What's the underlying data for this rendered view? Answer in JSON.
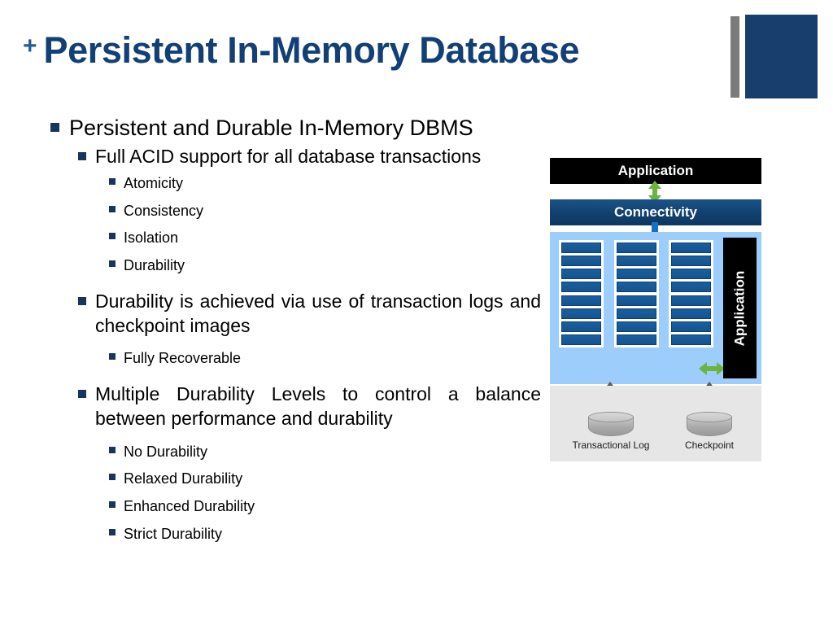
{
  "slide": {
    "title_prefix": "+",
    "title": "Persistent In-Memory Database"
  },
  "colors": {
    "title_blue": "#124076",
    "bullet_navy": "#18365c",
    "deco_block": "#173e6d",
    "deco_bar": "#7b7b7b",
    "connectivity_blue": "#11406f",
    "memory_bg": "#9dcdfa",
    "memory_row": "#14538f",
    "storage_bg": "#e6e6e6",
    "arrow_green": "#6cb33f",
    "arrow_blue": "#1b6fc2",
    "arrow_gray": "#5a5a5a",
    "black": "#000000",
    "white": "#ffffff"
  },
  "bullets": {
    "b1": "Persistent and Durable In-Memory DBMS",
    "b2": "Full ACID support for all database transactions",
    "acid": [
      "Atomicity",
      "Consistency",
      "Isolation",
      "Durability"
    ],
    "b3": "Durability is achieved via use of transaction logs and checkpoint images",
    "b3_sub": "Fully Recoverable",
    "b4": "Multiple Durability Levels to control a balance between performance and durability",
    "levels": [
      "No Durability",
      "Relaxed Durability",
      "Enhanced Durability",
      "Strict Durability"
    ]
  },
  "diagram": {
    "app_top_label": "Application",
    "connectivity_label": "Connectivity",
    "app_side_label": "Application",
    "memory_columns": 3,
    "memory_rows_per_column": 8,
    "storage": [
      {
        "name": "transactional-log",
        "label": "Transactional Log"
      },
      {
        "name": "checkpoint",
        "label": "Checkpoint"
      }
    ],
    "arrows": [
      {
        "name": "app-connectivity-arrow",
        "direction": "bidirectional-vertical",
        "color": "green"
      },
      {
        "name": "connectivity-memory-arrow",
        "direction": "down",
        "color": "blue"
      },
      {
        "name": "memory-app-arrow",
        "direction": "bidirectional-horizontal",
        "color": "green"
      },
      {
        "name": "memory-log-arrow",
        "direction": "bidirectional-vertical",
        "color": "gray"
      },
      {
        "name": "memory-checkpoint-arrow",
        "direction": "bidirectional-vertical",
        "color": "gray"
      }
    ]
  }
}
